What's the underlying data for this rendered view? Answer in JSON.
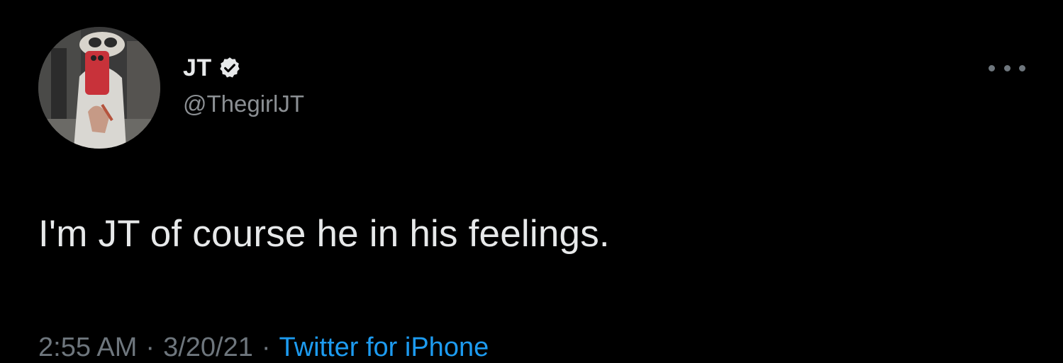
{
  "tweet": {
    "author": {
      "display_name": "JT",
      "handle": "@ThegirlJT",
      "verified": true
    },
    "text": "I'm JT of course he in his feelings.",
    "meta": {
      "time": "2:55 AM",
      "date": "3/20/21",
      "separator": "·",
      "source": "Twitter for iPhone"
    }
  },
  "icons": {
    "verified_badge": "verified-badge-icon",
    "more_options": "more-options-icon"
  },
  "colors": {
    "background": "#000000",
    "primary_text": "#e7e9ea",
    "secondary_text": "#8b8f93",
    "link": "#1d9bf0"
  }
}
